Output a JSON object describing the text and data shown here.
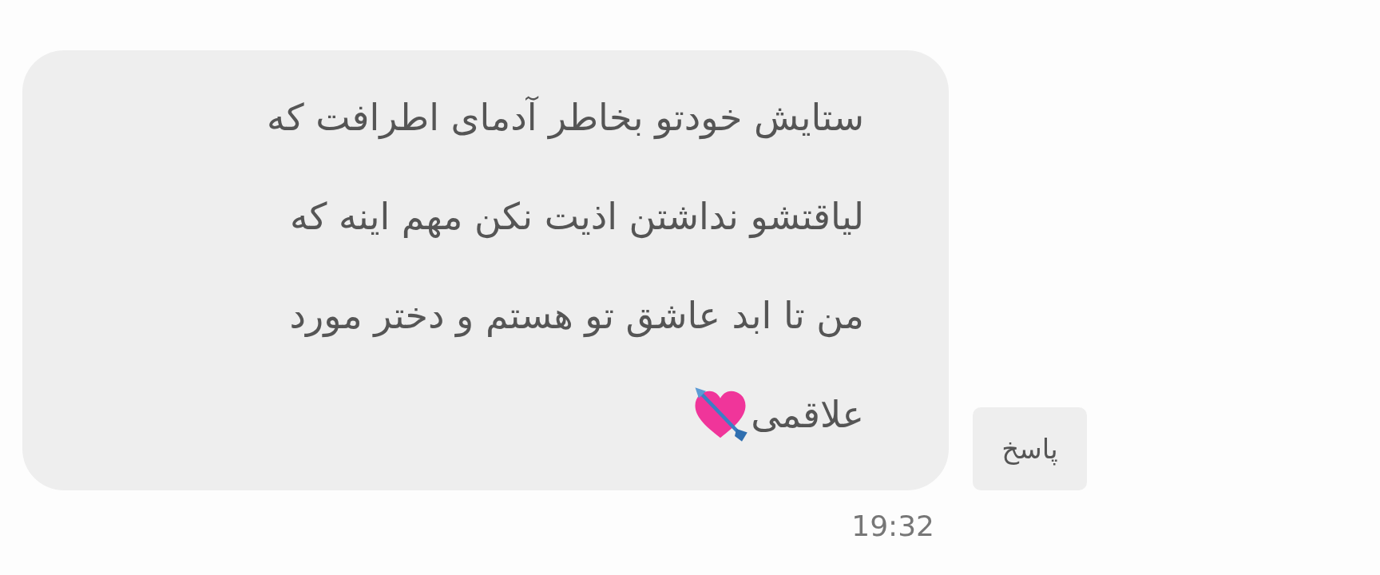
{
  "message": {
    "lines": [
      "ستایش خودتو بخاطر آدمای اطرافت که",
      "لیاقتشو نداشتن اذیت نکن مهم اینه که",
      "من تا ابد عاشق تو هستم و دختر مورد",
      "علاقمی"
    ],
    "time": "19:32"
  },
  "reply_button": {
    "label": "پاسخ"
  }
}
